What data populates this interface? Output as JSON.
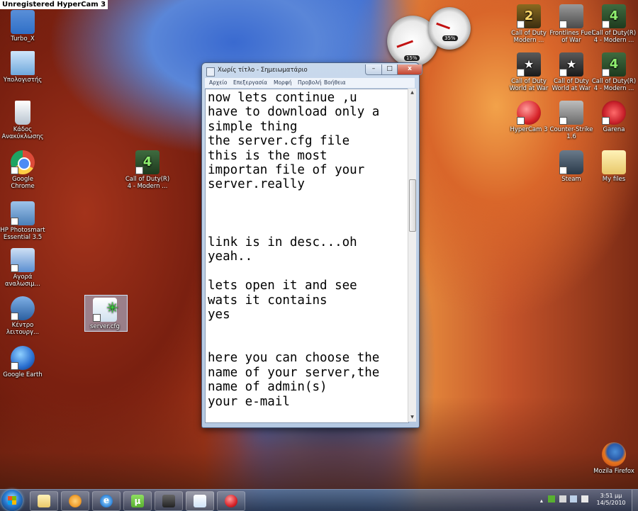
{
  "recording_banner": "Unregistered HyperCam 3",
  "desktop_left_icons": [
    {
      "name": "Turbo_X",
      "icon": "folder-icon",
      "color": "#2f6fc7"
    },
    {
      "name": "Υπολογιστής",
      "icon": "computer-icon",
      "color": "#6fa8dc"
    },
    {
      "name": "Κάδος Ανακύκλωσης",
      "icon": "recycle-bin-icon",
      "color": "#dfe6ee"
    },
    {
      "name": "Google Chrome",
      "icon": "chrome-icon",
      "color": "#dd4b39"
    },
    {
      "name": "HP Photosmart Essential 3.5",
      "icon": "hp-photosmart-icon",
      "color": "#4a7fb8"
    },
    {
      "name": "Αγορά αναλωσιμ...",
      "icon": "shopping-icon",
      "color": "#5b8fd1"
    },
    {
      "name": "Κέντρο λειτουργ...",
      "icon": "hp-center-icon",
      "color": "#2b5fa0"
    },
    {
      "name": "Google Earth",
      "icon": "google-earth-icon",
      "color": "#2a6fd0"
    }
  ],
  "desktop_middle_icons": [
    {
      "name": "Call of Duty(R) 4 - Modern ...",
      "icon": "cod4-icon",
      "color": "#1e3a1e"
    },
    {
      "name": "server.cfg",
      "icon": "cfg-file-icon",
      "color": "#e6f2fb"
    }
  ],
  "desktop_right_icons": [
    {
      "name": "Call of Duty Modern ...",
      "icon": "cod2-icon",
      "color": "#3a2d10"
    },
    {
      "name": "Frontlines Fuel of War",
      "icon": "frontlines-icon",
      "color": "#5a5a5a"
    },
    {
      "name": "Call of Duty(R) 4 - Modern ...",
      "icon": "cod4-icon",
      "color": "#1e3a1e"
    },
    {
      "name": "Call of Duty World at War",
      "icon": "codwaw-icon",
      "color": "#2a2a2a"
    },
    {
      "name": "Call of Duty World at War",
      "icon": "codwaw-icon",
      "color": "#2a2a2a"
    },
    {
      "name": "Call of Duty(R) 4 - Modern ...",
      "icon": "cod4-icon",
      "color": "#1e3a1e"
    },
    {
      "name": "HyperCam 3",
      "icon": "hypercam-icon",
      "color": "#d8242a"
    },
    {
      "name": "Counter-Strike 1.6",
      "icon": "counter-strike-icon",
      "color": "#7a7a7a"
    },
    {
      "name": "Garena",
      "icon": "garena-icon",
      "color": "#c8202a"
    },
    {
      "name": "Steam",
      "icon": "steam-icon",
      "color": "#3a4a5a"
    },
    {
      "name": "My files",
      "icon": "folder-icon",
      "color": "#e8c86a"
    },
    {
      "name": "Mozila Firefox",
      "icon": "firefox-icon",
      "color": "#e8761e"
    }
  ],
  "gadgets": {
    "cpu_percent": "15%",
    "memory_percent": "35%"
  },
  "notepad": {
    "title": "Χωρίς τίτλο - Σημειωματάριο",
    "controls": {
      "minimize": "–",
      "maximize": "□",
      "close": "x"
    },
    "menu": [
      "Αρχείο",
      "Επεξεργασία",
      "Μορφή",
      "Προβολή",
      "Βοήθεια"
    ],
    "content": "now lets continue ,u\nhave to download only a\nsimple thing\nthe server.cfg file\nthis is the most\nimportan file of your\nserver.really\n\n\n\nlink is in desc...oh\nyeah..\n\nlets open it and see\nwats it contains\nyes\n\n\nhere you can choose the\nname of your server,the\nname of admin(s)\nyour e-mail",
    "scroll_up": "▲",
    "scroll_down": "▼"
  },
  "taskbar": {
    "pinned": [
      {
        "icon": "explorer-folder-icon",
        "color": "#e8c86a"
      },
      {
        "icon": "media-player-icon",
        "color": "#f0a030"
      },
      {
        "icon": "internet-explorer-icon",
        "color": "#3a8ee0"
      },
      {
        "icon": "utorrent-icon",
        "color": "#58b030"
      },
      {
        "icon": "cod-taskbar-icon",
        "color": "#333333"
      },
      {
        "icon": "notepad-icon",
        "color": "#cfe3f7"
      },
      {
        "icon": "hypercam-taskbar-icon",
        "color": "#d8242a"
      }
    ],
    "clock_time": "3:51 μμ",
    "clock_date": "14/5/2010"
  }
}
